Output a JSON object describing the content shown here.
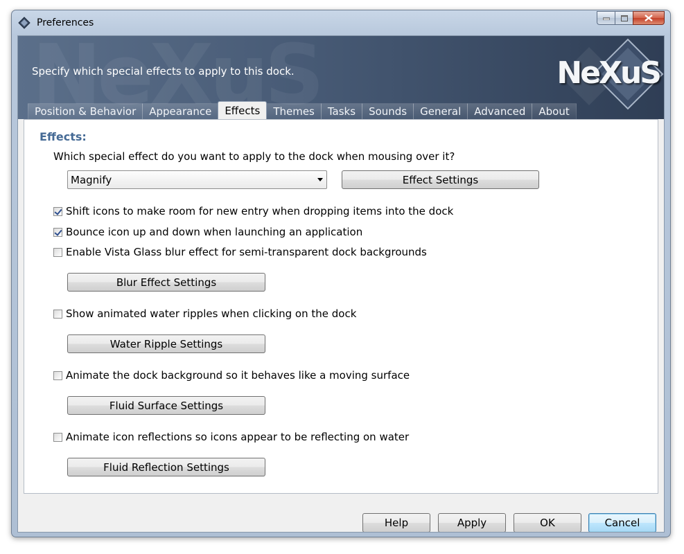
{
  "window": {
    "title": "Preferences"
  },
  "banner": {
    "description": "Specify which special effects to apply to this dock.",
    "logo_text": "NeXuS"
  },
  "tabs": [
    {
      "label": "Position & Behavior",
      "active": false
    },
    {
      "label": "Appearance",
      "active": false
    },
    {
      "label": "Effects",
      "active": true
    },
    {
      "label": "Themes",
      "active": false
    },
    {
      "label": "Tasks",
      "active": false
    },
    {
      "label": "Sounds",
      "active": false
    },
    {
      "label": "General",
      "active": false
    },
    {
      "label": "Advanced",
      "active": false
    },
    {
      "label": "About",
      "active": false
    }
  ],
  "effects": {
    "section_title": "Effects:",
    "question": "Which special effect do you want to apply to the dock when mousing over it?",
    "effect_select_value": "Magnify",
    "effect_settings_label": "Effect Settings",
    "options": [
      {
        "label": "Shift icons to make room for new entry when dropping items into the dock",
        "checked": true
      },
      {
        "label": "Bounce icon up and down when launching an application",
        "checked": true
      },
      {
        "label": "Enable Vista Glass blur effect for semi-transparent dock backgrounds",
        "checked": false
      },
      {
        "label": "Show animated water ripples when clicking on the dock",
        "checked": false
      },
      {
        "label": "Animate the dock background so it behaves like a moving surface",
        "checked": false
      },
      {
        "label": "Animate icon reflections so icons appear to be reflecting on water",
        "checked": false
      }
    ],
    "blur_settings_label": "Blur Effect Settings",
    "ripple_settings_label": "Water Ripple Settings",
    "surface_settings_label": "Fluid Surface Settings",
    "reflection_settings_label": "Fluid Reflection Settings"
  },
  "footer": {
    "help_label": "Help",
    "apply_label": "Apply",
    "ok_label": "OK",
    "cancel_label": "Cancel"
  },
  "colors": {
    "section_title": "#456a95",
    "banner_dark": "#2f3e55",
    "checkmark": "#2e4f8f"
  }
}
